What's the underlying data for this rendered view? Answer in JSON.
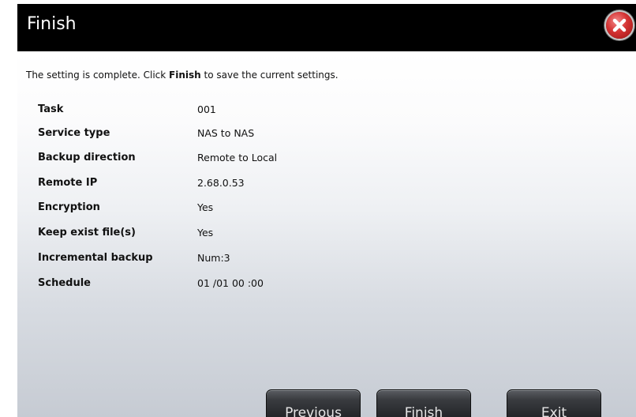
{
  "dialog": {
    "title": "Finish",
    "close_icon": "close-icon",
    "intro": {
      "before": "The setting is complete. Click ",
      "bold": "Finish",
      "after": " to save the current settings."
    },
    "summary": [
      {
        "label": "Task",
        "value": "001"
      },
      {
        "label": "Service type",
        "value": "NAS to NAS"
      },
      {
        "label": "Backup direction",
        "value": "Remote to Local"
      },
      {
        "label": "Remote IP",
        "value": "2.68.0.53"
      },
      {
        "label": "Encryption",
        "value": "Yes"
      },
      {
        "label": "Keep exist file(s)",
        "value": "Yes"
      },
      {
        "label": "Incremental backup",
        "value": "Num:3"
      },
      {
        "label": "Schedule",
        "value": "01 /01 00 :00"
      }
    ],
    "buttons": {
      "previous": "Previous",
      "finish": "Finish",
      "exit": "Exit"
    }
  },
  "colors": {
    "titlebar": "#000000",
    "close_button": "#d43232",
    "button": "#2b2d30"
  }
}
